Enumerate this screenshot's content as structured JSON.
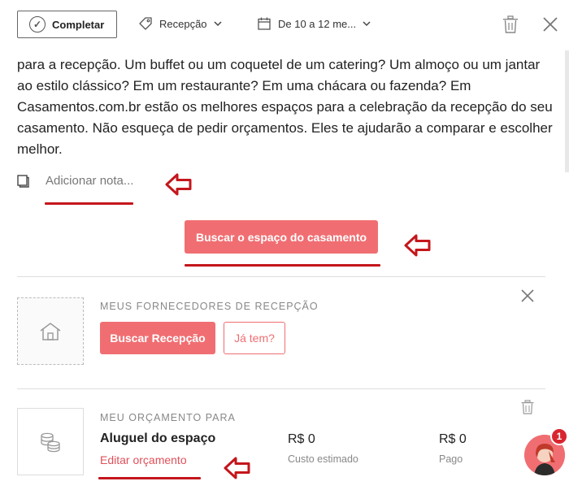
{
  "toolbar": {
    "complete_label": "Completar",
    "category": "Recepção",
    "date_range": "De 10 a 12 me..."
  },
  "description": "para a recepção. Um buffet ou um coquetel de um catering? Um almoço ou um jantar ao estilo clássico? Em um restaurante? Em uma chácara ou fazenda? Em Casamentos.com.br estão os melhores espaços para a celebração da recepção do seu casamento. Não esqueça de pedir orçamentos. Eles te ajudarão a comparar e escolher melhor.",
  "note": {
    "placeholder": "Adicionar nota..."
  },
  "main_cta": "Buscar o espaço do casamento",
  "providers": {
    "label": "MEUS FORNECEDORES DE RECEPÇÃO",
    "search_button": "Buscar Recepção",
    "have_button": "Já tem?"
  },
  "budget": {
    "label": "MEU ORÇAMENTO PARA",
    "title": "Aluguel do espaço",
    "edit_link": "Editar orçamento",
    "estimated_value": "R$ 0",
    "estimated_label": "Custo estimado",
    "paid_value": "R$ 0",
    "paid_label": "Pago"
  },
  "chat": {
    "badge": "1"
  },
  "colors": {
    "accent": "#f06e72",
    "annotation_red": "#c4161c"
  },
  "icons": [
    "check-circle-icon",
    "tag-icon",
    "calendar-icon",
    "chevron-down-icon",
    "trash-icon",
    "close-icon",
    "note-icon",
    "house-icon",
    "coins-icon",
    "arrow-left-icon"
  ]
}
